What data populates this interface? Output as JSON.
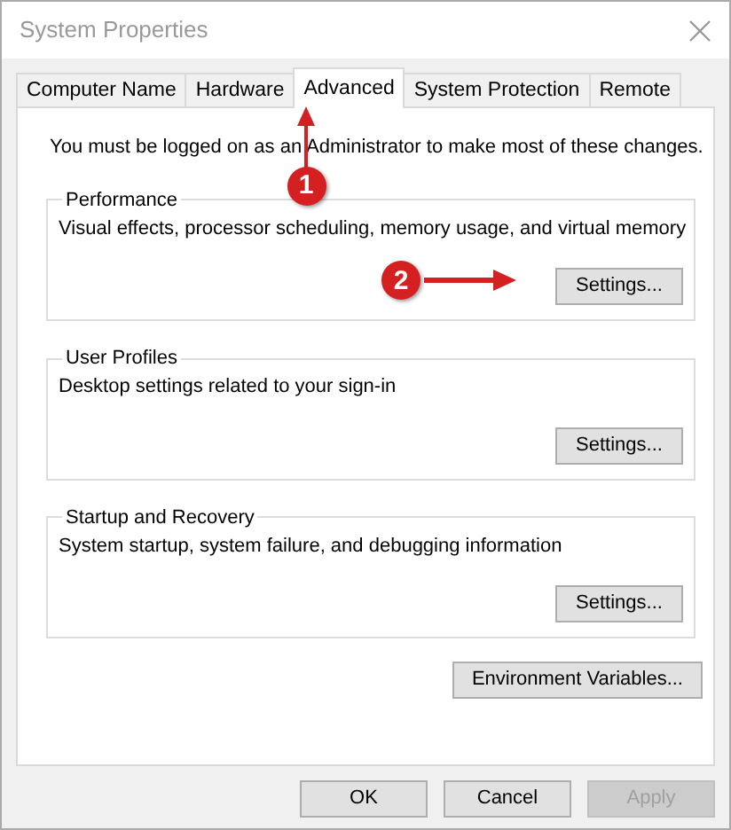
{
  "window": {
    "title": "System Properties"
  },
  "tabs": [
    {
      "label": "Computer Name",
      "selected": false
    },
    {
      "label": "Hardware",
      "selected": false
    },
    {
      "label": "Advanced",
      "selected": true
    },
    {
      "label": "System Protection",
      "selected": false
    },
    {
      "label": "Remote",
      "selected": false
    }
  ],
  "notice": "You must be logged on as an Administrator to make most of these changes.",
  "groups": [
    {
      "title": "Performance",
      "description": "Visual effects, processor scheduling, memory usage, and virtual memory",
      "button": "Settings..."
    },
    {
      "title": "User Profiles",
      "description": "Desktop settings related to your sign-in",
      "button": "Settings..."
    },
    {
      "title": "Startup and Recovery",
      "description": "System startup, system failure, and debugging information",
      "button": "Settings..."
    }
  ],
  "environment_button": "Environment Variables...",
  "dialog_buttons": [
    {
      "label": "OK",
      "disabled": false
    },
    {
      "label": "Cancel",
      "disabled": false
    },
    {
      "label": "Apply",
      "disabled": true
    }
  ],
  "annotations": [
    {
      "number": "1"
    },
    {
      "number": "2"
    }
  ]
}
